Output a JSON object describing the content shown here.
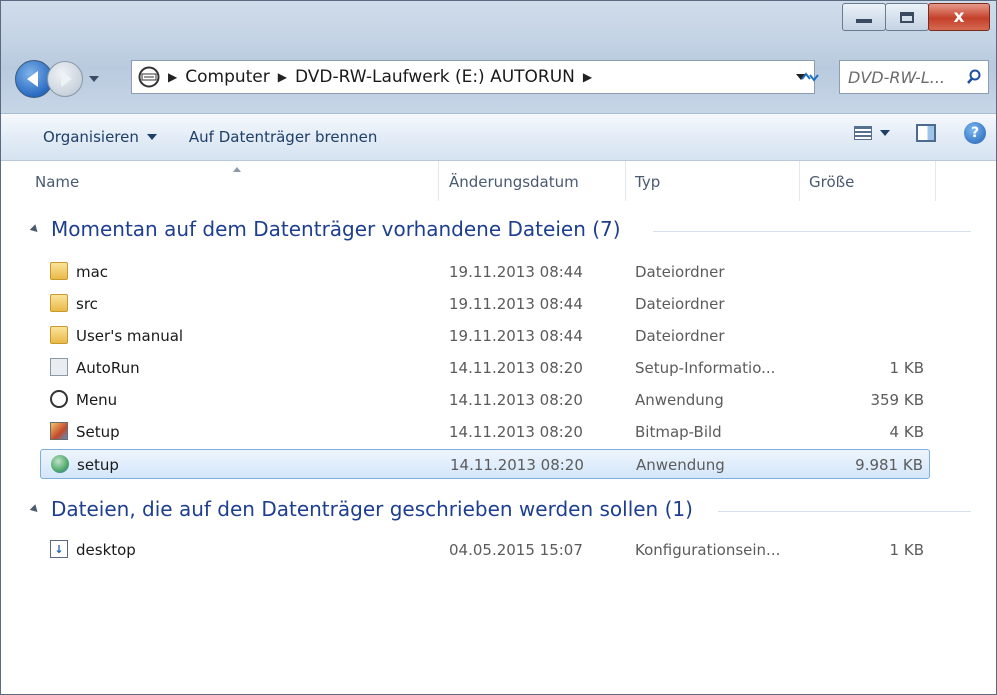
{
  "window": {
    "controls": {
      "minimize": "–",
      "maximize": "□",
      "close": "x"
    }
  },
  "address": {
    "crumbs": [
      "Computer",
      "DVD-RW-Laufwerk (E:) AUTORUN"
    ],
    "search_placeholder": "DVD-RW-L..."
  },
  "toolbar": {
    "organize_label": "Organisieren",
    "burn_label": "Auf Datenträger brennen"
  },
  "columns": {
    "name": "Name",
    "date": "Änderungsdatum",
    "type": "Typ",
    "size": "Größe"
  },
  "groups": [
    {
      "label": "Momentan auf dem Datenträger vorhandene Dateien (7)",
      "items": [
        {
          "name": "mac",
          "date": "19.11.2013 08:44",
          "type": "Dateiordner",
          "size": "",
          "icon": "folder-icon"
        },
        {
          "name": "src",
          "date": "19.11.2013 08:44",
          "type": "Dateiordner",
          "size": "",
          "icon": "folder-icon"
        },
        {
          "name": "User's manual",
          "date": "19.11.2013 08:44",
          "type": "Dateiordner",
          "size": "",
          "icon": "folder-icon"
        },
        {
          "name": "AutoRun",
          "date": "14.11.2013 08:20",
          "type": "Setup-Informatio...",
          "size": "1 KB",
          "icon": "setup-info-icon"
        },
        {
          "name": "Menu",
          "date": "14.11.2013 08:20",
          "type": "Anwendung",
          "size": "359 KB",
          "icon": "dvd-app-icon"
        },
        {
          "name": "Setup",
          "date": "14.11.2013 08:20",
          "type": "Bitmap-Bild",
          "size": "4 KB",
          "icon": "bitmap-icon"
        },
        {
          "name": "setup",
          "date": "14.11.2013 08:20",
          "type": "Anwendung",
          "size": "9.981 KB",
          "icon": "installer-icon",
          "selected": true
        }
      ]
    },
    {
      "label": "Dateien, die auf den Datenträger geschrieben werden sollen (1)",
      "items": [
        {
          "name": "desktop",
          "date": "04.05.2015 15:07",
          "type": "Konfigurationsein...",
          "size": "1 KB",
          "icon": "config-file-icon"
        }
      ]
    }
  ]
}
